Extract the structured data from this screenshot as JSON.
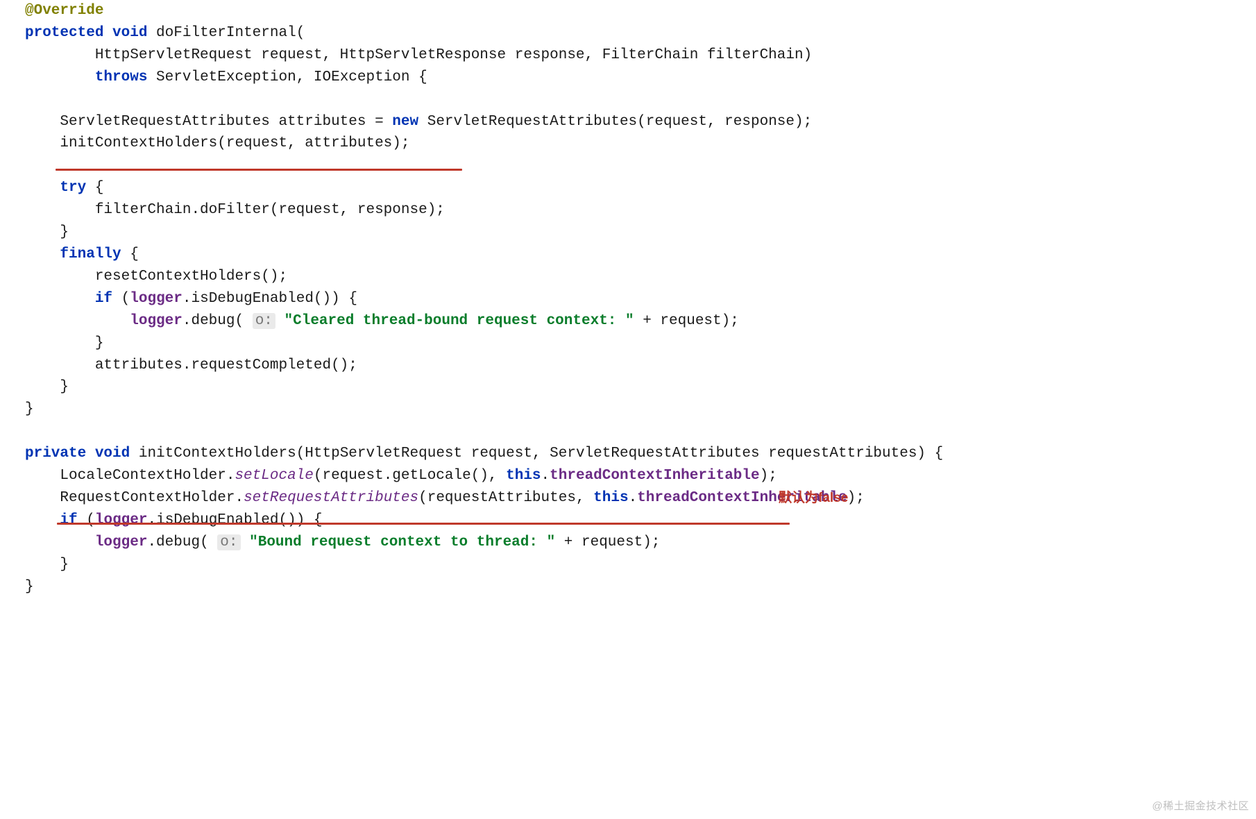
{
  "code": {
    "l1": "@Override",
    "l2a": "protected",
    "l2b": "void",
    "l2c": " doFilterInternal(",
    "l3": "        HttpServletRequest request, HttpServletResponse response, FilterChain filterChain)",
    "l4a": "        ",
    "l4b": "throws",
    "l4c": " ServletException, IOException {",
    "l5": "",
    "l6a": "    ServletRequestAttributes attributes = ",
    "l6b": "new",
    "l6c": " ServletRequestAttributes(request, response);",
    "l7": "    initContextHolders(request, attributes);",
    "l8": "",
    "l9a": "    ",
    "l9b": "try",
    "l9c": " {",
    "l10": "        filterChain.doFilter(request, response);",
    "l11": "    }",
    "l12a": "    ",
    "l12b": "finally",
    "l12c": " {",
    "l13": "        resetContextHolders();",
    "l14a": "        ",
    "l14b": "if",
    "l14c": " (",
    "l14d": "logger",
    "l14e": ".isDebugEnabled()) {",
    "l15a": "            ",
    "l15b": "logger",
    "l15c": ".debug( ",
    "l15hint": "o:",
    "l15d": " ",
    "l15s": "\"Cleared thread-bound request context: \"",
    "l15e": " + request);",
    "l16": "        }",
    "l17": "        attributes.requestCompleted();",
    "l18": "    }",
    "l19": "}",
    "l20": "",
    "l21a": "private",
    "l21b": "void",
    "l21c": " initContextHolders(HttpServletRequest request, ServletRequestAttributes requestAttributes) {",
    "l22a": "    LocaleContextHolder.",
    "l22m": "setLocale",
    "l22b": "(request.getLocale(), ",
    "l22t": "this",
    "l22c": ".",
    "l22f": "threadContextInheritable",
    "l22d": ");",
    "l23a": "    RequestContextHolder.",
    "l23m": "setRequestAttributes",
    "l23b": "(requestAttributes, ",
    "l23t": "this",
    "l23c": ".",
    "l23f": "threadContextInheritable",
    "l23d": ");",
    "l24a": "    ",
    "l24b": "if",
    "l24c": " (",
    "l24d": "logger",
    "l24e": ".isDebugEnabled()) {",
    "l25a": "        ",
    "l25b": "logger",
    "l25c": ".debug( ",
    "l25hint": "o:",
    "l25d": " ",
    "l25s": "\"Bound request context to thread: \"",
    "l25e": " + request);",
    "l26": "    }",
    "l27": "}"
  },
  "annotation": "默认为false",
  "watermark": "@稀土掘金技术社区"
}
